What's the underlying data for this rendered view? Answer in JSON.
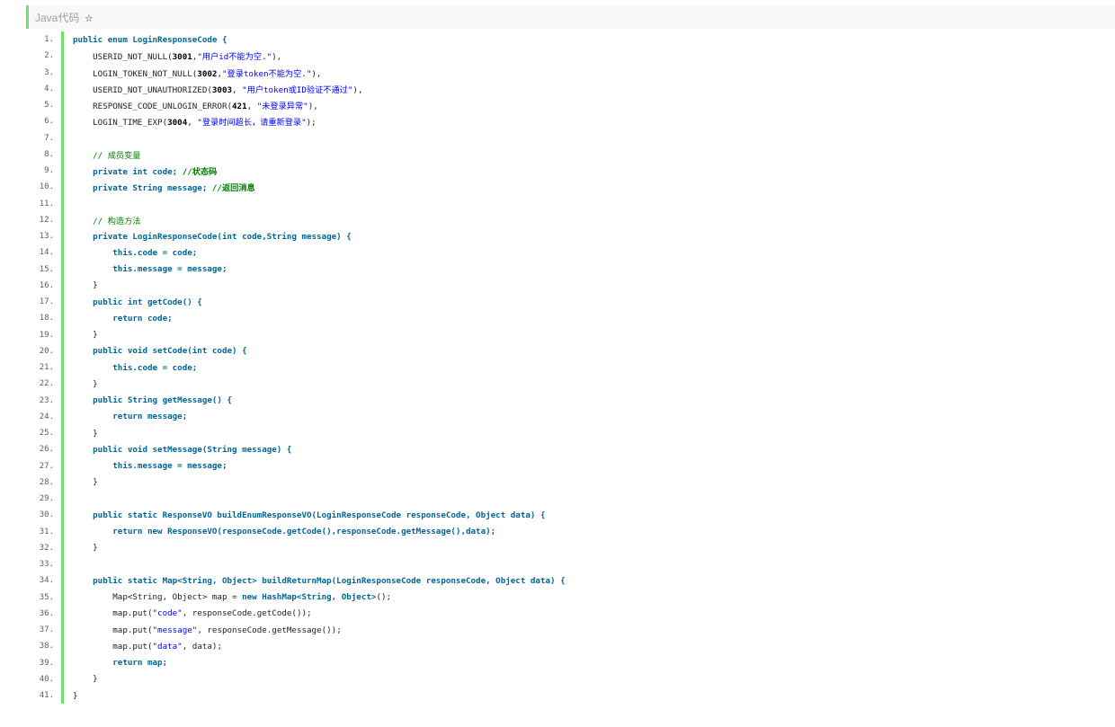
{
  "header": {
    "title": "Java代码",
    "star_icon": "star-icon"
  },
  "colors": {
    "gutter_bar": "#6ce26c",
    "keyword": "#006699",
    "string": "#0000ff",
    "comment": "#008200"
  },
  "lines": [
    {
      "n": "1.",
      "s": [
        [
          "kw",
          "public enum LoginResponseCode {"
        ]
      ]
    },
    {
      "n": "2.",
      "s": [
        [
          "pl",
          "    USERID_NOT_NULL("
        ],
        [
          "bd",
          "3001"
        ],
        [
          "pl",
          ","
        ],
        [
          "str",
          "\"用户id不能为空.\""
        ],
        [
          "pl",
          "),"
        ]
      ]
    },
    {
      "n": "3.",
      "s": [
        [
          "pl",
          "    LOGIN_TOKEN_NOT_NULL("
        ],
        [
          "bd",
          "3002"
        ],
        [
          "pl",
          ","
        ],
        [
          "str",
          "\"登录token不能为空.\""
        ],
        [
          "pl",
          "),"
        ]
      ]
    },
    {
      "n": "4.",
      "s": [
        [
          "pl",
          "    USERID_NOT_UNAUTHORIZED("
        ],
        [
          "bd",
          "3003"
        ],
        [
          "pl",
          ", "
        ],
        [
          "str",
          "\"用户token或ID验证不通过\""
        ],
        [
          "pl",
          "),"
        ]
      ]
    },
    {
      "n": "5.",
      "s": [
        [
          "pl",
          "    RESPONSE_CODE_UNLOGIN_ERROR("
        ],
        [
          "bd",
          "421"
        ],
        [
          "pl",
          ", "
        ],
        [
          "str",
          "\"未登录异常\""
        ],
        [
          "pl",
          "),"
        ]
      ]
    },
    {
      "n": "6.",
      "s": [
        [
          "pl",
          "    LOGIN_TIME_EXP("
        ],
        [
          "bd",
          "3004"
        ],
        [
          "pl",
          ", "
        ],
        [
          "str",
          "\"登录时间超长，请重新登录\""
        ],
        [
          "pl",
          ");"
        ]
      ]
    },
    {
      "n": "7.",
      "s": []
    },
    {
      "n": "8.",
      "s": [
        [
          "cm",
          "    // 成员变量"
        ]
      ]
    },
    {
      "n": "9.",
      "s": [
        [
          "kw",
          "    private int code; "
        ],
        [
          "cmb",
          "//状态码"
        ]
      ]
    },
    {
      "n": "10.",
      "s": [
        [
          "kw",
          "    private String message; "
        ],
        [
          "cmb",
          "//返回消息"
        ]
      ]
    },
    {
      "n": "11.",
      "s": []
    },
    {
      "n": "12.",
      "s": [
        [
          "cm",
          "    // 构造方法"
        ]
      ]
    },
    {
      "n": "13.",
      "s": [
        [
          "kw",
          "    private LoginResponseCode(int code,String message) {"
        ]
      ]
    },
    {
      "n": "14.",
      "s": [
        [
          "kw",
          "        this.code = code;"
        ]
      ]
    },
    {
      "n": "15.",
      "s": [
        [
          "kw",
          "        this.message = message;"
        ]
      ]
    },
    {
      "n": "16.",
      "s": [
        [
          "pl",
          "    }"
        ]
      ]
    },
    {
      "n": "17.",
      "s": [
        [
          "kw",
          "    public int getCode() {"
        ]
      ]
    },
    {
      "n": "18.",
      "s": [
        [
          "kw",
          "        return code;"
        ]
      ]
    },
    {
      "n": "19.",
      "s": [
        [
          "pl",
          "    }"
        ]
      ]
    },
    {
      "n": "20.",
      "s": [
        [
          "kw",
          "    public void setCode(int code) {"
        ]
      ]
    },
    {
      "n": "21.",
      "s": [
        [
          "kw",
          "        this.code = code;"
        ]
      ]
    },
    {
      "n": "22.",
      "s": [
        [
          "pl",
          "    }"
        ]
      ]
    },
    {
      "n": "23.",
      "s": [
        [
          "kw",
          "    public String getMessage() {"
        ]
      ]
    },
    {
      "n": "24.",
      "s": [
        [
          "kw",
          "        return message;"
        ]
      ]
    },
    {
      "n": "25.",
      "s": [
        [
          "pl",
          "    }"
        ]
      ]
    },
    {
      "n": "26.",
      "s": [
        [
          "kw",
          "    public void setMessage(String message) {"
        ]
      ]
    },
    {
      "n": "27.",
      "s": [
        [
          "kw",
          "        this.message = message;"
        ]
      ]
    },
    {
      "n": "28.",
      "s": [
        [
          "pl",
          "    }"
        ]
      ]
    },
    {
      "n": "29.",
      "s": []
    },
    {
      "n": "30.",
      "s": [
        [
          "kw",
          "    public static ResponseVO buildEnumResponseVO(LoginResponseCode responseCode, Object data) {"
        ]
      ]
    },
    {
      "n": "31.",
      "s": [
        [
          "kw",
          "        return new ResponseVO(responseCode.getCode(),responseCode.getMessage(),data);"
        ]
      ]
    },
    {
      "n": "32.",
      "s": [
        [
          "pl",
          "    }"
        ]
      ]
    },
    {
      "n": "33.",
      "s": []
    },
    {
      "n": "34.",
      "s": [
        [
          "kw",
          "    public static Map<String, Object> buildReturnMap(LoginResponseCode responseCode, Object data) {"
        ]
      ]
    },
    {
      "n": "35.",
      "s": [
        [
          "pl",
          "        Map<String, Object> map = "
        ],
        [
          "kw",
          "new HashMap<String, Object>"
        ],
        [
          "pl",
          "();"
        ]
      ]
    },
    {
      "n": "36.",
      "s": [
        [
          "pl",
          "        map.put("
        ],
        [
          "str",
          "\"code\""
        ],
        [
          "pl",
          ", responseCode.getCode());"
        ]
      ]
    },
    {
      "n": "37.",
      "s": [
        [
          "pl",
          "        map.put("
        ],
        [
          "str",
          "\"message\""
        ],
        [
          "pl",
          ", responseCode.getMessage());"
        ]
      ]
    },
    {
      "n": "38.",
      "s": [
        [
          "pl",
          "        map.put("
        ],
        [
          "str",
          "\"data\""
        ],
        [
          "pl",
          ", data);"
        ]
      ]
    },
    {
      "n": "39.",
      "s": [
        [
          "kw",
          "        return map;"
        ]
      ]
    },
    {
      "n": "40.",
      "s": [
        [
          "pl",
          "    }"
        ]
      ]
    },
    {
      "n": "41.",
      "s": [
        [
          "pl",
          "}"
        ]
      ]
    }
  ]
}
